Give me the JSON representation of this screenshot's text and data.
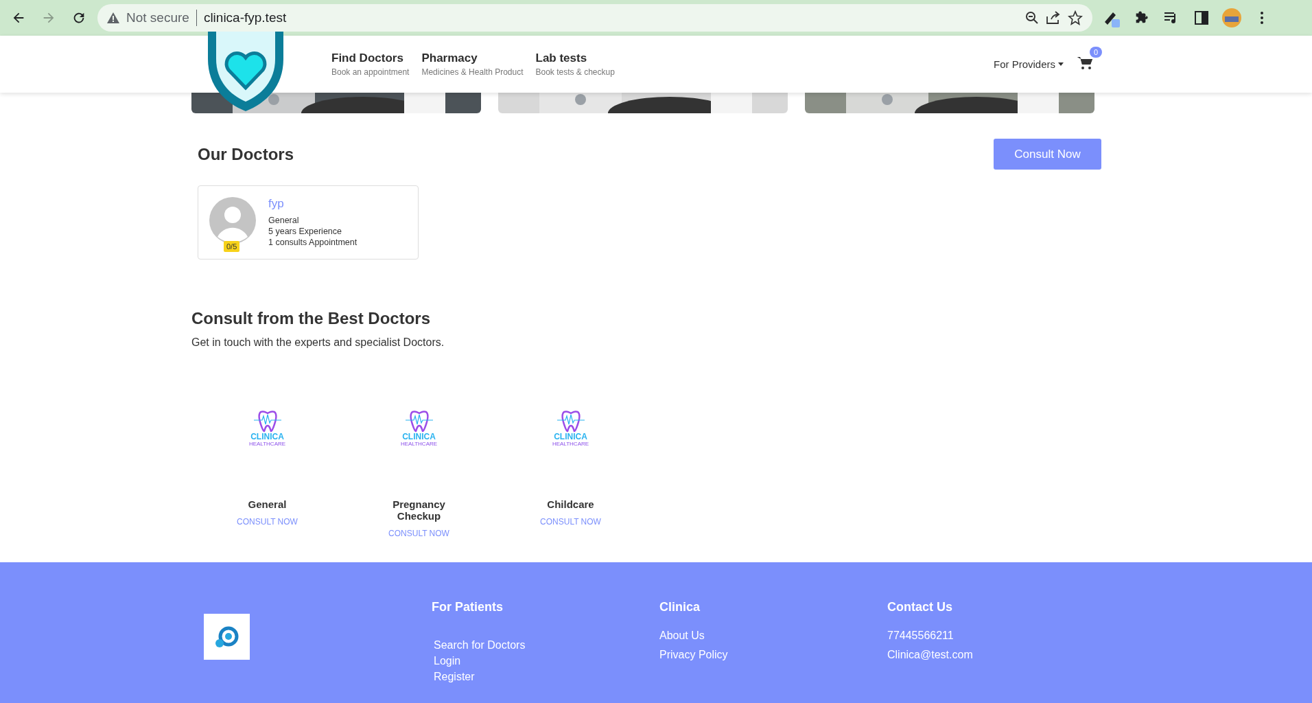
{
  "browser": {
    "security": "Not secure",
    "url": "clinica-fyp.test",
    "forward_disabled": true
  },
  "nav": {
    "items": [
      {
        "title": "Find Doctors",
        "subtitle": "Book an appointment"
      },
      {
        "title": "Pharmacy",
        "subtitle": "Medicines & Health Product"
      },
      {
        "title": "Lab tests",
        "subtitle": "Book tests & checkup"
      }
    ],
    "providers": "For Providers",
    "cart_count": "0"
  },
  "our_doctors": {
    "title": "Our Doctors",
    "button": "Consult Now",
    "doctors": [
      {
        "name": "fyp",
        "rating": "0/5",
        "specialty": "General",
        "experience": "5 years Experience",
        "consults": "1 consults Appointment"
      }
    ]
  },
  "consult": {
    "title": "Consult from the Best Doctors",
    "subtitle": "Get in touch with the experts and specialist Doctors.",
    "specialties": [
      {
        "logo_name": "CLINICA",
        "logo_sub": "HEALTHCARE",
        "name": "General",
        "link": "CONSULT NOW"
      },
      {
        "logo_name": "CLINICA",
        "logo_sub": "HEALTHCARE",
        "name": "Pregnancy Checkup",
        "link": "CONSULT NOW"
      },
      {
        "logo_name": "CLINICA",
        "logo_sub": "HEALTHCARE",
        "name": "Childcare",
        "link": "CONSULT NOW"
      }
    ]
  },
  "footer": {
    "columns": [
      {
        "heading": "For Patients",
        "kind": "list",
        "links": [
          "Search for Doctors",
          "Login",
          "Register"
        ]
      },
      {
        "heading": "Clinica",
        "kind": "spaced",
        "links": [
          "About Us",
          "Privacy Policy"
        ]
      },
      {
        "heading": "Contact Us",
        "kind": "spaced",
        "links": [
          "77445566211",
          "Clinica@test.com"
        ]
      }
    ]
  }
}
